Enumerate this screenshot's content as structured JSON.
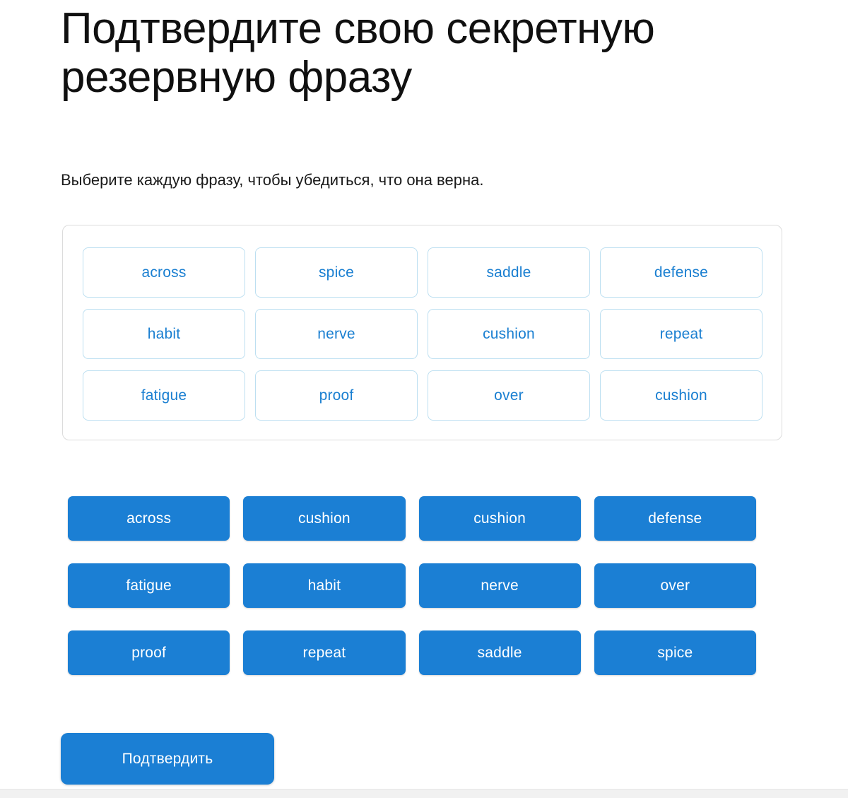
{
  "header": {
    "title": "Подтвердите свою секретную резервную фразу",
    "subtitle": "Выберите каждую фразу, чтобы убедиться, что она верна."
  },
  "phrase_panel": {
    "chips": [
      {
        "label": "across"
      },
      {
        "label": "spice"
      },
      {
        "label": "saddle"
      },
      {
        "label": "defense"
      },
      {
        "label": "habit"
      },
      {
        "label": "nerve"
      },
      {
        "label": "cushion"
      },
      {
        "label": "repeat"
      },
      {
        "label": "fatigue"
      },
      {
        "label": "proof"
      },
      {
        "label": "over"
      },
      {
        "label": "cushion"
      }
    ]
  },
  "word_bank": {
    "words": [
      {
        "label": "across"
      },
      {
        "label": "cushion"
      },
      {
        "label": "cushion"
      },
      {
        "label": "defense"
      },
      {
        "label": "fatigue"
      },
      {
        "label": "habit"
      },
      {
        "label": "nerve"
      },
      {
        "label": "over"
      },
      {
        "label": "proof"
      },
      {
        "label": "repeat"
      },
      {
        "label": "saddle"
      },
      {
        "label": "spice"
      }
    ]
  },
  "actions": {
    "confirm_label": "Подтвердить"
  },
  "colors": {
    "accent_blue": "#1b7fd4",
    "chip_text_blue": "#1a7fd1",
    "chip_border_blue": "#bcdff1",
    "panel_border_gray": "#dcdcdc",
    "text_black": "#101010",
    "background": "#ffffff"
  }
}
